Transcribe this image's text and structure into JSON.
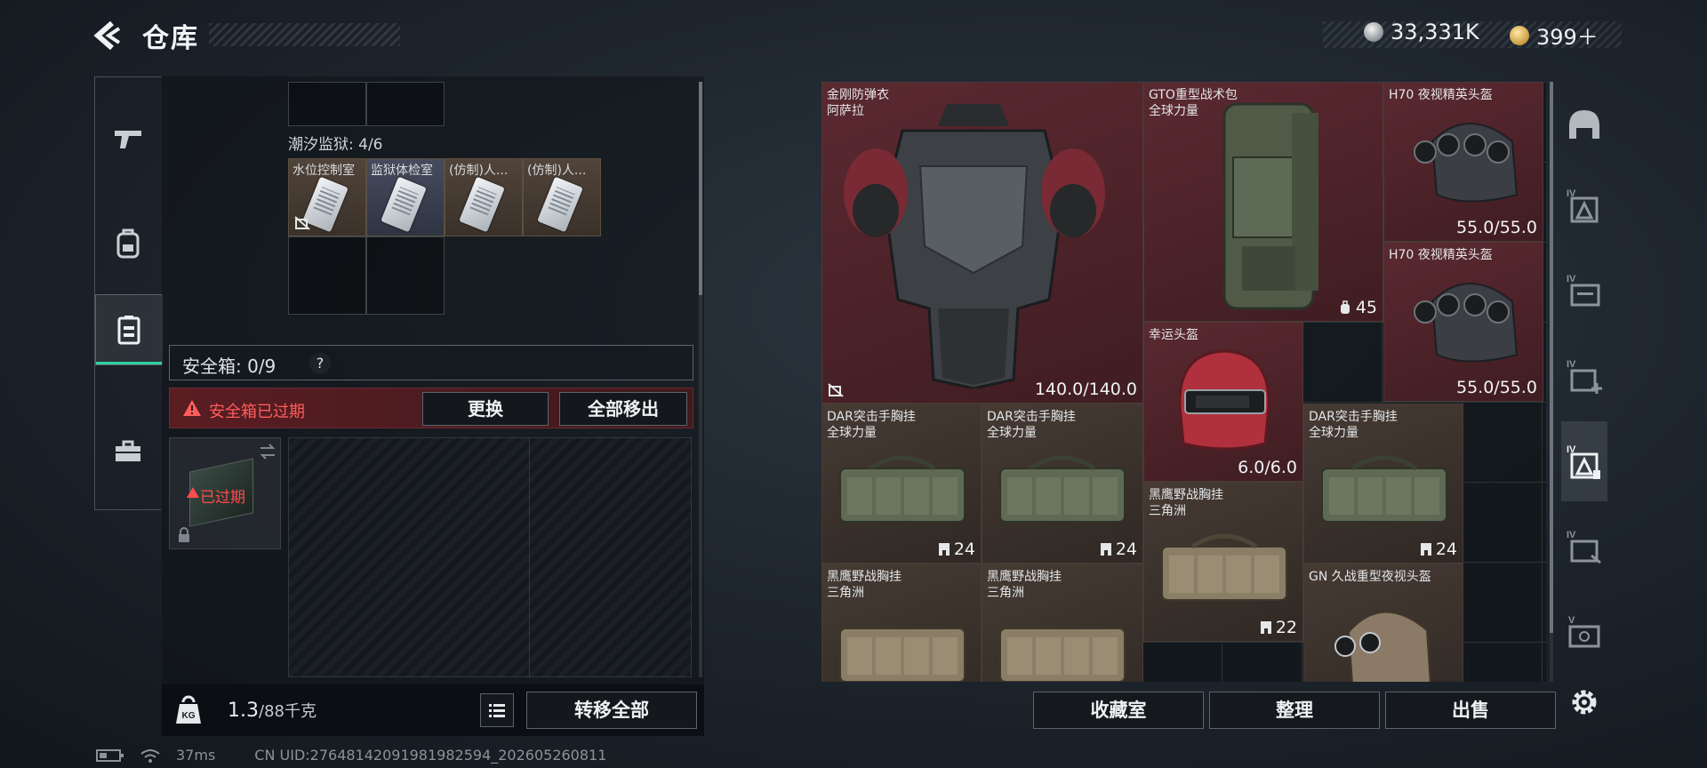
{
  "header": {
    "title": "仓库",
    "currency_silver": "33,331K",
    "currency_gold": "399＋"
  },
  "left_nav": {
    "items": [
      {
        "icon": "gun-icon"
      },
      {
        "icon": "backpack-icon"
      },
      {
        "icon": "vest-icon",
        "active": true
      },
      {
        "icon": "toolbox-icon"
      }
    ]
  },
  "container": {
    "section_label": "潮汐监狱: 4/6",
    "cards": [
      {
        "label": "水位控制室",
        "locked": true
      },
      {
        "label": "监狱体检室"
      },
      {
        "label": "(仿制)人..."
      },
      {
        "label": "(仿制)人..."
      }
    ]
  },
  "safe_box": {
    "label": "安全箱: 0/9",
    "help": "?",
    "expired_text": "安全箱已过期",
    "replace_label": "更换",
    "remove_all_label": "全部移出",
    "case_status": "已过期"
  },
  "weight": {
    "current": "1.3",
    "max": "/88千克",
    "transfer_all_label": "转移全部"
  },
  "inventory": {
    "items": [
      {
        "name1": "金刚防弹衣",
        "name2": "阿萨拉",
        "value": "140.0/140.0",
        "bg": "red"
      },
      {
        "name1": "GTO重型战术包",
        "name2": "全球力量",
        "capacity": "45",
        "bg": "red"
      },
      {
        "name1": "H70 夜视精英头盔",
        "value": "55.0/55.0",
        "bg": "red"
      },
      {
        "name1": "H70 夜视精英头盔",
        "value": "55.0/55.0",
        "bg": "red"
      },
      {
        "name1": "幸运头盔",
        "value": "6.0/6.0",
        "bg": "red"
      },
      {
        "name1": "DAR突击手胸挂",
        "name2": "全球力量",
        "slots": "24",
        "bg": "brown"
      },
      {
        "name1": "DAR突击手胸挂",
        "name2": "全球力量",
        "slots": "24",
        "bg": "brown"
      },
      {
        "name1": "DAR突击手胸挂",
        "name2": "全球力量",
        "slots": "24",
        "bg": "brown"
      },
      {
        "name1": "黑鹰野战胸挂",
        "name2": "三角洲",
        "slots": "22",
        "bg": "brown"
      },
      {
        "name1": "黑鹰野战胸挂",
        "name2": "三角洲",
        "bg": "brown"
      },
      {
        "name1": "黑鹰野战胸挂",
        "name2": "三角洲",
        "bg": "brown"
      },
      {
        "name1": "GN 久战重型夜视头盔",
        "bg": "brown"
      }
    ]
  },
  "right_tabs": [
    {
      "icon": "helmet-icon"
    },
    {
      "icon": "armor-tier-icon",
      "tier": "IV"
    },
    {
      "icon": "folder-tier-icon",
      "tier": "IV"
    },
    {
      "icon": "add-tier-icon",
      "tier": "IV"
    },
    {
      "icon": "armor-select-icon",
      "tier": "IV",
      "active": true
    },
    {
      "icon": "stack-tier-icon",
      "tier": "IV"
    },
    {
      "icon": "vehicle-tier-icon",
      "tier": "V"
    },
    {
      "icon": "settings-icon"
    }
  ],
  "bottom_actions": {
    "collection_label": "收藏室",
    "sort_label": "整理",
    "sell_label": "出售"
  },
  "status": {
    "ping": "37ms",
    "uid": "CN UID:27648142091981982594_202605260811"
  },
  "colors": {
    "accent": "#2fd3a0",
    "warning": "#ff5c5c",
    "red_item_bg": "#5b2930",
    "brown_item_bg": "#463b33"
  }
}
